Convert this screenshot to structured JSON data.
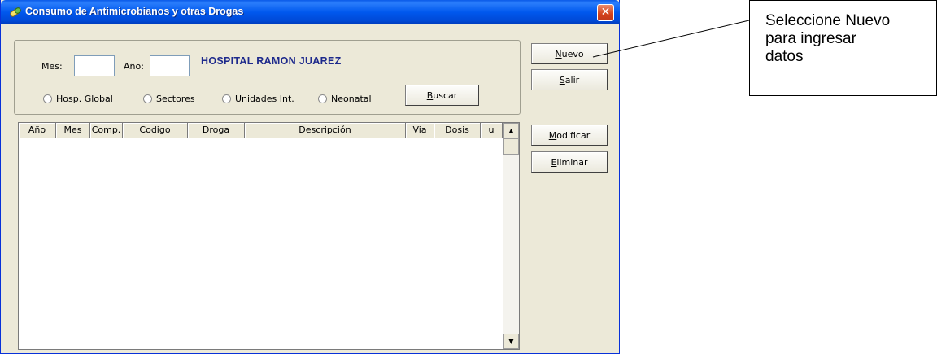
{
  "window": {
    "title": "Consumo de Antimicrobianos y otras Drogas",
    "close_label": "✕",
    "icon": "pill-icon"
  },
  "filters": {
    "mes_label": "Mes:",
    "mes_value": "",
    "anio_label": "Año:",
    "anio_value": "",
    "hospital_name": "HOSPITAL RAMON JUAREZ",
    "radios": [
      {
        "label": "Hosp. Global",
        "checked": false
      },
      {
        "label": "Sectores",
        "checked": false
      },
      {
        "label": "Unidades Int.",
        "checked": false
      },
      {
        "label": "Neonatal",
        "checked": false
      }
    ],
    "search_button": {
      "accel": "B",
      "rest": "uscar"
    }
  },
  "buttons": {
    "nuevo": {
      "accel": "N",
      "rest": "uevo"
    },
    "salir": {
      "accel": "S",
      "rest": "alir"
    },
    "modificar": {
      "accel": "M",
      "rest": "odificar"
    },
    "eliminar": {
      "accel": "E",
      "rest": "liminar"
    }
  },
  "grid": {
    "columns": [
      "Año",
      "Mes",
      "Comp.",
      "Codigo",
      "Droga",
      "Descripción",
      "Via",
      "Dosis",
      "u"
    ],
    "rows": []
  },
  "callout": {
    "lines": [
      "Seleccione Nuevo",
      "para ingresar",
      "datos"
    ]
  },
  "colors": {
    "titlebar": "#0058ee",
    "hospital_text": "#1e2a8c",
    "window_bg": "#ece9d8"
  }
}
